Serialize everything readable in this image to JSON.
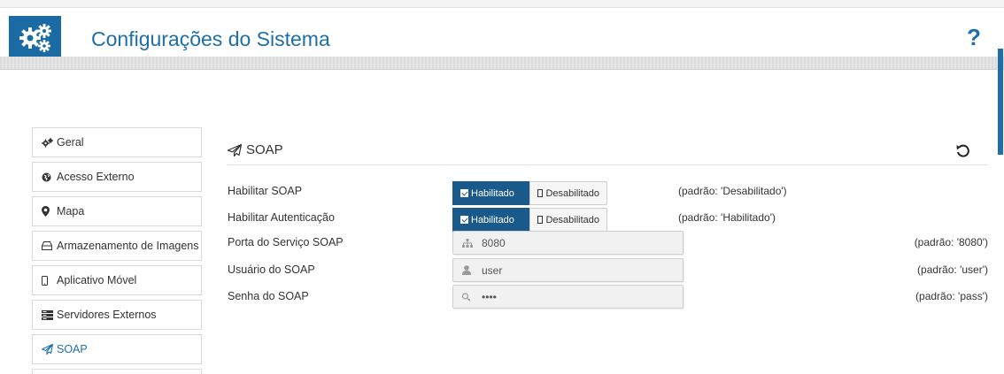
{
  "header": {
    "title": "Configurações do Sistema",
    "help_label": "?",
    "logo_icon": "gears-icon",
    "accent_color": "#1e6fa8"
  },
  "sidebar": {
    "items": [
      {
        "label": "Geral",
        "icon": "gears-icon"
      },
      {
        "label": "Acesso Externo",
        "icon": "globe-icon"
      },
      {
        "label": "Mapa",
        "icon": "map-marker-icon"
      },
      {
        "label": "Armazenamento de Imagens",
        "icon": "hdd-icon"
      },
      {
        "label": "Aplicativo Móvel",
        "icon": "mobile-icon"
      },
      {
        "label": "Servidores Externos",
        "icon": "server-icon"
      },
      {
        "label": "SOAP",
        "icon": "paper-plane-icon",
        "active": true
      }
    ]
  },
  "panel": {
    "title": "SOAP",
    "icon": "paper-plane-icon",
    "reset_icon": "undo-icon",
    "rows": {
      "enable_soap": {
        "label": "Habilitar SOAP",
        "on_label": "Habilitado",
        "off_label": "Desabilitado",
        "selected": "Habilitado",
        "default": "(padrão: 'Desabilitado')"
      },
      "enable_auth": {
        "label": "Habilitar Autenticação",
        "on_label": "Habilitado",
        "off_label": "Desabilitado",
        "selected": "Habilitado",
        "default": "(padrão: 'Habilitado')"
      },
      "port": {
        "label": "Porta do Serviço SOAP",
        "value": "8080",
        "icon": "sitemap-icon",
        "default": "(padrão: '8080')"
      },
      "user": {
        "label": "Usuário do SOAP",
        "value": "user",
        "icon": "user-icon",
        "default": "(padrão: 'user')"
      },
      "password": {
        "label": "Senha do SOAP",
        "value": "pass",
        "icon": "key-icon",
        "default": "(padrão: 'pass')"
      }
    }
  }
}
